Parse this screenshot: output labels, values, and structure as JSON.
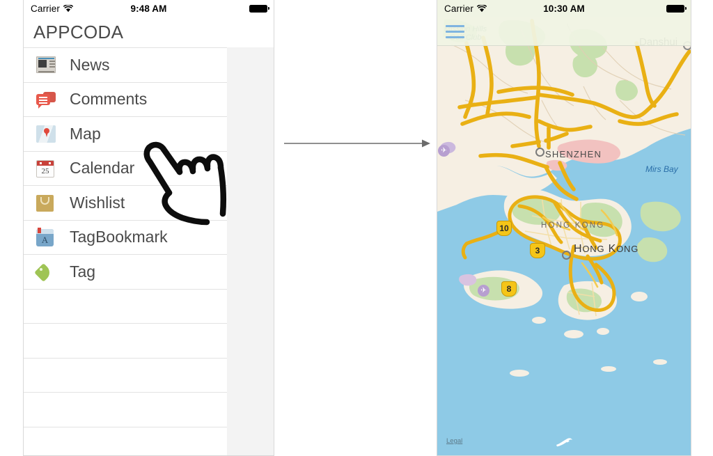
{
  "left_phone": {
    "status_bar": {
      "carrier": "Carrier",
      "time": "9:48 AM",
      "wifi_icon": "wifi-icon",
      "battery_icon": "battery-icon"
    },
    "nav": {
      "title": "APPCODA",
      "menu_icon": "hamburger-icon"
    },
    "menu_items": [
      {
        "label": "News",
        "icon": "news-icon"
      },
      {
        "label": "Comments",
        "icon": "comments-icon"
      },
      {
        "label": "Map",
        "icon": "map-icon"
      },
      {
        "label": "Calendar",
        "icon": "calendar-icon",
        "day": "25"
      },
      {
        "label": "Wishlist",
        "icon": "shopping-bag-icon"
      },
      {
        "label": "Bookmark",
        "icon": "bookmark-icon",
        "letter": "A"
      },
      {
        "label": "Tag",
        "icon": "tag-icon"
      }
    ],
    "empty_row_count": 5
  },
  "arrow": {
    "name": "flow-arrow",
    "direction": "right",
    "color": "#6b6b6b"
  },
  "hand_cursor": {
    "name": "pointing-hand-cursor",
    "targets_item": "Map"
  },
  "right_phone": {
    "status_bar": {
      "carrier": "Carrier",
      "time": "10:30 AM",
      "wifi_icon": "wifi-icon",
      "battery_icon": "battery-icon"
    },
    "nav": {
      "menu_icon": "hamburger-icon"
    },
    "map": {
      "legal_link": "Legal",
      "compass_icon": "compass-icon",
      "labels": [
        {
          "text": "Mission Hills",
          "type": "poi"
        },
        {
          "text": "Golf Club",
          "type": "poi"
        },
        {
          "text": "Danshui",
          "type": "town"
        },
        {
          "text": "SHENZHEN",
          "type": "city"
        },
        {
          "text": "Mirs Bay",
          "type": "water"
        },
        {
          "text": "HONG KONG",
          "type": "region"
        },
        {
          "text": "Hong Kong",
          "type": "city"
        }
      ],
      "route_shields": [
        "10",
        "3",
        "8"
      ],
      "colors": {
        "water": "#8ecae6",
        "land": "#f6efe3",
        "green": "#c7e0ae",
        "road": "#f5c518",
        "urban_red": "#f2c2c0"
      }
    }
  }
}
